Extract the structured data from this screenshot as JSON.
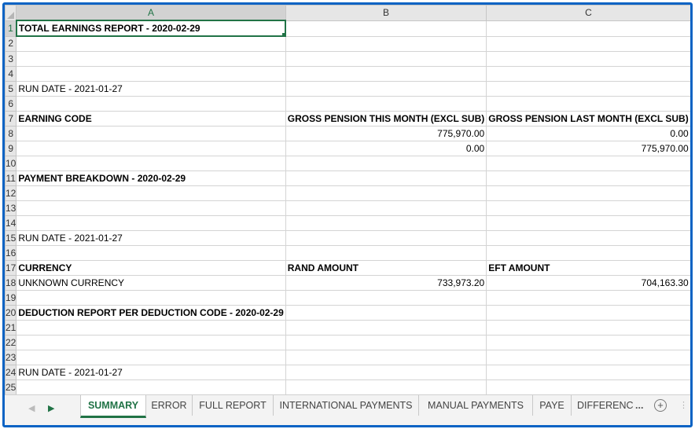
{
  "sheet": {
    "columns": [
      "A",
      "B",
      "C"
    ],
    "active_cell": "A1",
    "rows": [
      {
        "n": "1",
        "a": "TOTAL EARNINGS REPORT - 2020-02-29",
        "b": "",
        "c": "",
        "bold": true
      },
      {
        "n": "2",
        "a": "",
        "b": "",
        "c": ""
      },
      {
        "n": "3",
        "a": "",
        "b": "",
        "c": ""
      },
      {
        "n": "4",
        "a": "",
        "b": "",
        "c": ""
      },
      {
        "n": "5",
        "a": "RUN DATE - 2021-01-27",
        "b": "",
        "c": ""
      },
      {
        "n": "6",
        "a": "",
        "b": "",
        "c": ""
      },
      {
        "n": "7",
        "a": "EARNING CODE",
        "b": "GROSS PENSION THIS MONTH (EXCL SUB)",
        "c": "GROSS PENSION LAST MONTH (EXCL SUB)",
        "bold": true
      },
      {
        "n": "8",
        "a": "",
        "b": "775,970.00",
        "c": "0.00",
        "numeric": true
      },
      {
        "n": "9",
        "a": "",
        "b": "0.00",
        "c": "775,970.00",
        "numeric": true
      },
      {
        "n": "10",
        "a": "",
        "b": "",
        "c": ""
      },
      {
        "n": "11",
        "a": "PAYMENT BREAKDOWN - 2020-02-29",
        "b": "",
        "c": "",
        "bold": true
      },
      {
        "n": "12",
        "a": "",
        "b": "",
        "c": ""
      },
      {
        "n": "13",
        "a": "",
        "b": "",
        "c": ""
      },
      {
        "n": "14",
        "a": "",
        "b": "",
        "c": ""
      },
      {
        "n": "15",
        "a": "RUN DATE - 2021-01-27",
        "b": "",
        "c": ""
      },
      {
        "n": "16",
        "a": "",
        "b": "",
        "c": ""
      },
      {
        "n": "17",
        "a": "CURRENCY",
        "b": "RAND AMOUNT",
        "c": "EFT AMOUNT",
        "bold": true
      },
      {
        "n": "18",
        "a": "UNKNOWN CURRENCY",
        "b": "733,973.20",
        "c": "704,163.30",
        "numeric": true
      },
      {
        "n": "19",
        "a": "",
        "b": "",
        "c": ""
      },
      {
        "n": "20",
        "a": "DEDUCTION REPORT PER DEDUCTION CODE - 2020-02-29",
        "b": "",
        "c": "",
        "bold": true
      },
      {
        "n": "21",
        "a": "",
        "b": "",
        "c": ""
      },
      {
        "n": "22",
        "a": "",
        "b": "",
        "c": ""
      },
      {
        "n": "23",
        "a": "",
        "b": "",
        "c": ""
      },
      {
        "n": "24",
        "a": "RUN DATE - 2021-01-27",
        "b": "",
        "c": ""
      },
      {
        "n": "25",
        "a": "",
        "b": "",
        "c": ""
      }
    ]
  },
  "tabs": {
    "items": [
      "SUMMARY",
      "ERROR",
      "FULL REPORT",
      "INTERNATIONAL PAYMENTS",
      "MANUAL PAYMENTS",
      "PAYE",
      "DIFFERENC"
    ],
    "active": "SUMMARY",
    "overflow": "...",
    "add_symbol": "+"
  },
  "colors": {
    "frame": "#0a63c4",
    "accent": "#217346"
  }
}
